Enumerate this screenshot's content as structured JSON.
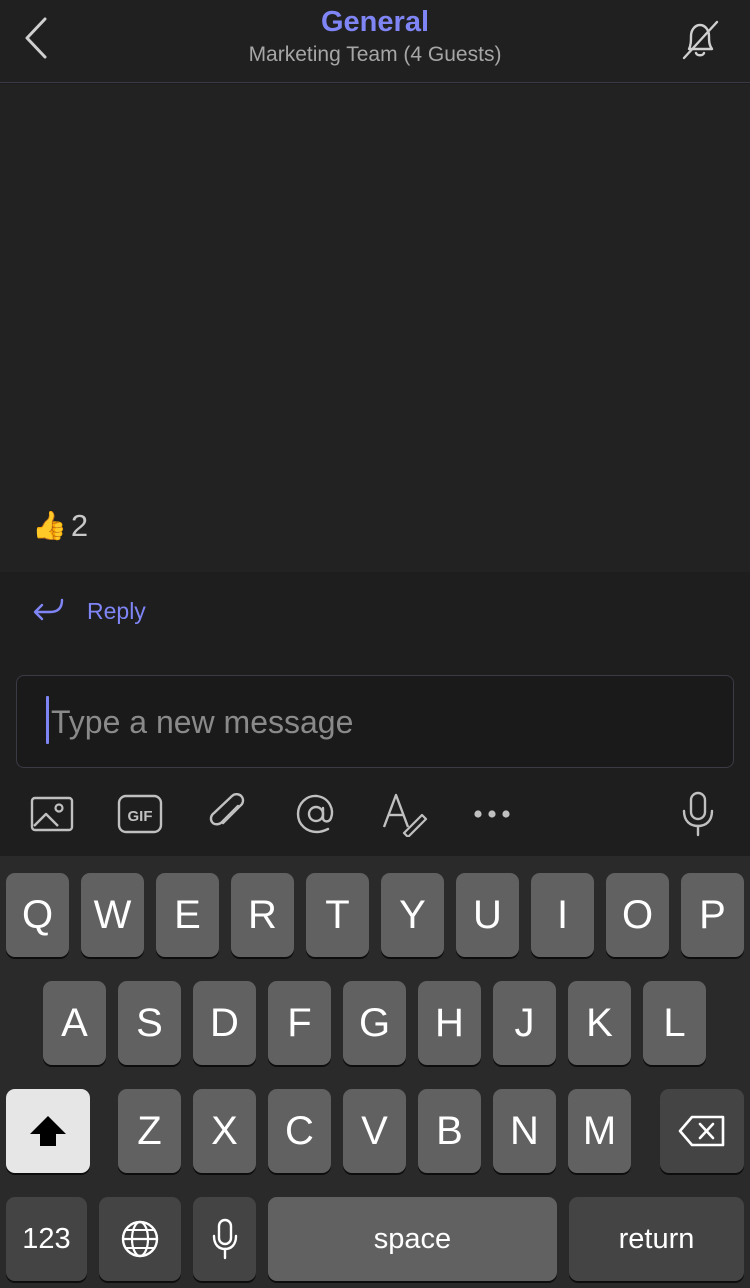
{
  "header": {
    "title": "General",
    "subtitle": "Marketing Team (4 Guests)",
    "back_icon": "chevron-left-icon",
    "mute_icon": "bell-off-icon"
  },
  "reaction": {
    "emoji": "👍",
    "count": "2"
  },
  "reply": {
    "label": "Reply",
    "icon": "reply-arrow-icon"
  },
  "composer": {
    "placeholder": "Type a new message",
    "value": ""
  },
  "toolbar": {
    "image_icon": "image-icon",
    "gif_label": "GIF",
    "attach_icon": "paperclip-icon",
    "mention_icon": "at-icon",
    "format_icon": "format-text-icon",
    "more_icon": "more-dots-icon",
    "mic_icon": "microphone-icon"
  },
  "keyboard": {
    "row1": [
      "Q",
      "W",
      "E",
      "R",
      "T",
      "Y",
      "U",
      "I",
      "O",
      "P"
    ],
    "row2": [
      "A",
      "S",
      "D",
      "F",
      "G",
      "H",
      "J",
      "K",
      "L"
    ],
    "row3": [
      "Z",
      "X",
      "C",
      "V",
      "B",
      "N",
      "M"
    ],
    "numbers_label": "123",
    "space_label": "space",
    "return_label": "return"
  },
  "colors": {
    "accent": "#7f85f5",
    "background": "#222222",
    "key": "#616161"
  }
}
